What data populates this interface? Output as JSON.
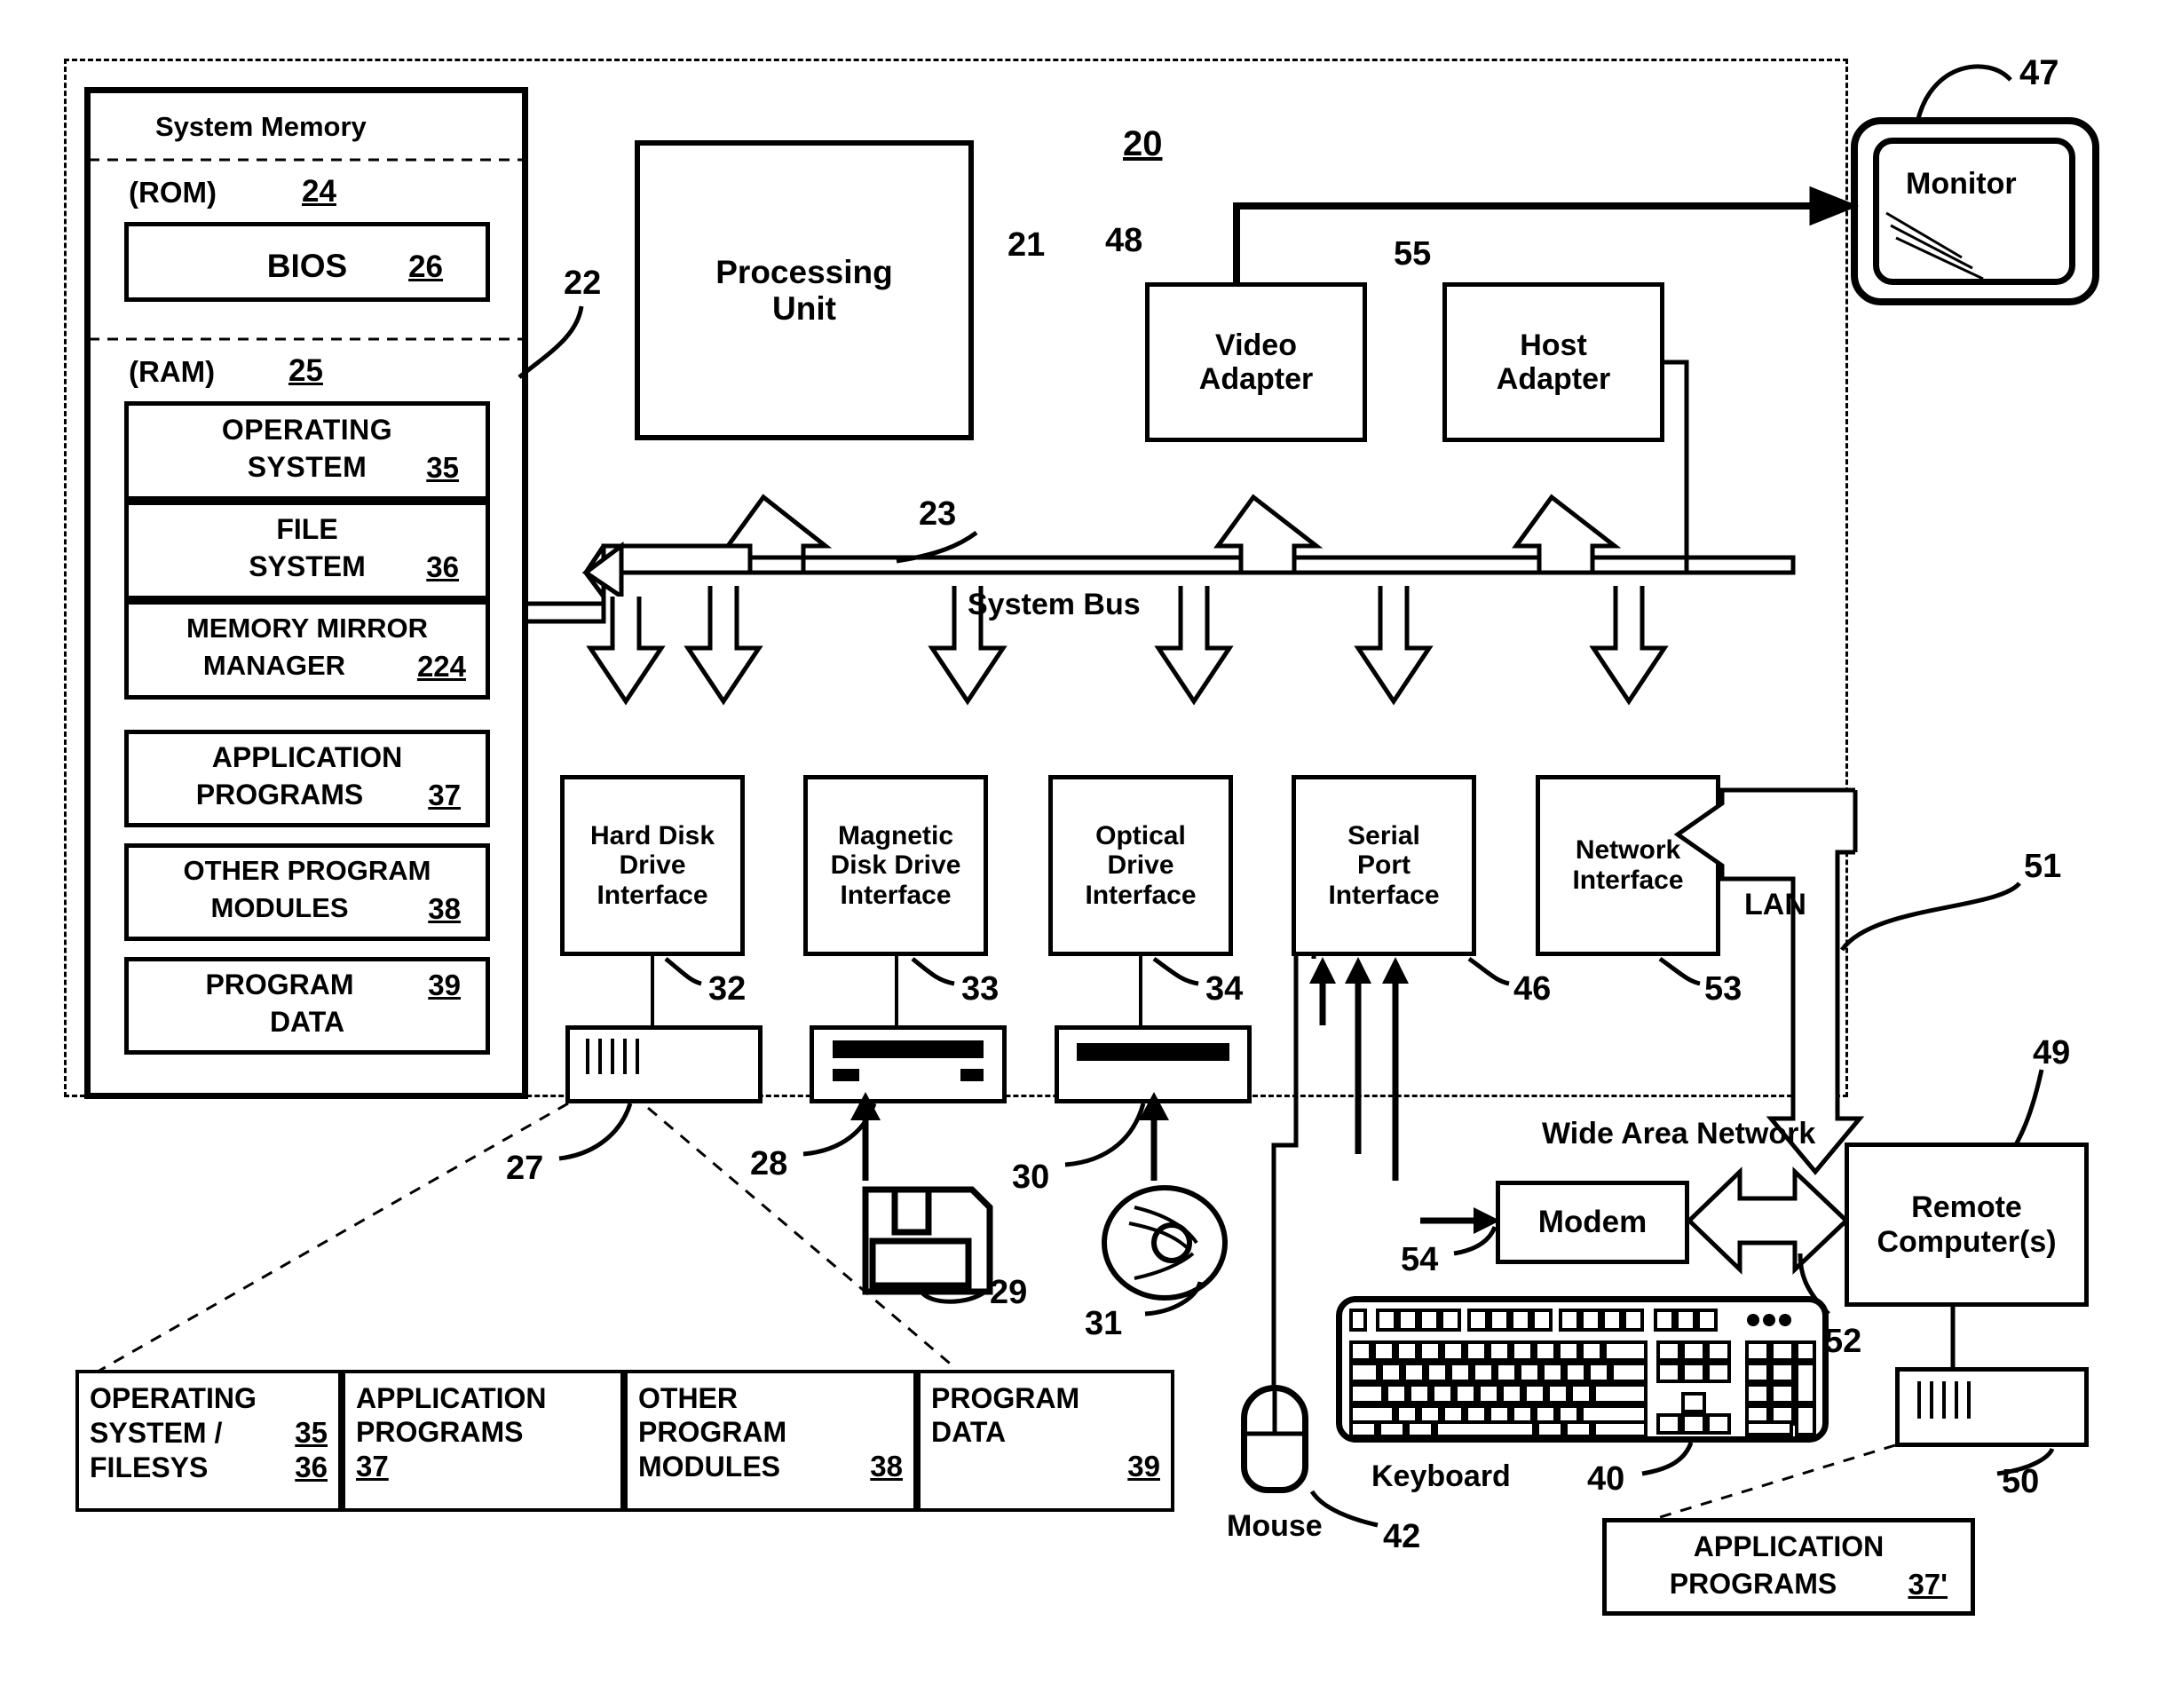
{
  "figure": {
    "overall_ref": "20",
    "system_memory_title": "System Memory",
    "rom_label": "(ROM)",
    "rom_ref": "24",
    "bios_label": "BIOS",
    "bios_ref": "26",
    "ram_label": "(RAM)",
    "ram_ref": "25",
    "system_bus_label": "System Bus",
    "system_bus_ref": "23",
    "memory_bus_ref": "22",
    "lan_label": "LAN",
    "lan_ref": "51",
    "wan_label": "Wide Area Network",
    "wan_ref": "49"
  },
  "ram_modules": [
    {
      "line1": "OPERATING",
      "line2": "SYSTEM",
      "ref": "35"
    },
    {
      "line1": "FILE",
      "line2": "SYSTEM",
      "ref": "36"
    },
    {
      "line1": "MEMORY MIRROR",
      "line2": "MANAGER",
      "ref": "224"
    },
    {
      "line1": "APPLICATION",
      "line2": "PROGRAMS",
      "ref": "37"
    },
    {
      "line1": "OTHER  PROGRAM",
      "line2": "MODULES",
      "ref": "38"
    },
    {
      "line1": "PROGRAM",
      "line2": "DATA",
      "ref": "39"
    }
  ],
  "units": {
    "processing_unit": {
      "line1": "Processing",
      "line2": "Unit",
      "ref": "21"
    },
    "video_adapter": {
      "line1": "Video",
      "line2": "Adapter",
      "ref": "48"
    },
    "host_adapter": {
      "line1": "Host",
      "line2": "Adapter",
      "ref": "55"
    },
    "monitor": {
      "label": "Monitor",
      "ref": "47"
    }
  },
  "interfaces": [
    {
      "line1": "Hard Disk",
      "line2": "Drive",
      "line3": "Interface",
      "ref": "32"
    },
    {
      "line1": "Magnetic",
      "line2": "Disk Drive",
      "line3": "Interface",
      "ref": "33"
    },
    {
      "line1": "Optical",
      "line2": "Drive",
      "line3": "Interface",
      "ref": "34"
    },
    {
      "line1": "Serial",
      "line2": "Port",
      "line3": "Interface",
      "ref": "46"
    },
    {
      "line1": "Network",
      "line2": "Interface",
      "line3": "",
      "ref": "53"
    }
  ],
  "drives": {
    "hard_disk_ref": "27",
    "magnetic_drive_ref": "28",
    "floppy_disk_ref": "29",
    "optical_drive_ref": "30",
    "optical_disc_ref": "31"
  },
  "peripherals": {
    "keyboard_label": "Keyboard",
    "keyboard_ref": "40",
    "mouse_label": "Mouse",
    "mouse_ref": "42",
    "modem_label": "Modem",
    "modem_ref": "54",
    "remote_computer": {
      "line1": "Remote",
      "line2": "Computer(s)",
      "ref": "52"
    },
    "remote_storage_ref": "50"
  },
  "storage_table": {
    "cells": [
      {
        "line1": "OPERATING",
        "line2": "SYSTEM /",
        "ref2": "35",
        "line3": "FILESYS",
        "ref3": "36"
      },
      {
        "line1": "APPLICATION",
        "line2": "PROGRAMS",
        "ref2": "37"
      },
      {
        "line1": "OTHER",
        "line2": "PROGRAM",
        "line3": "MODULES",
        "ref3": "38"
      },
      {
        "line1": "PROGRAM",
        "line2": "DATA",
        "ref3": "39"
      }
    ]
  },
  "remote_app_programs": {
    "line1": "APPLICATION",
    "line2": "PROGRAMS",
    "ref": "37'"
  },
  "colors": {
    "ink": "#000000",
    "paper": "#ffffff"
  }
}
